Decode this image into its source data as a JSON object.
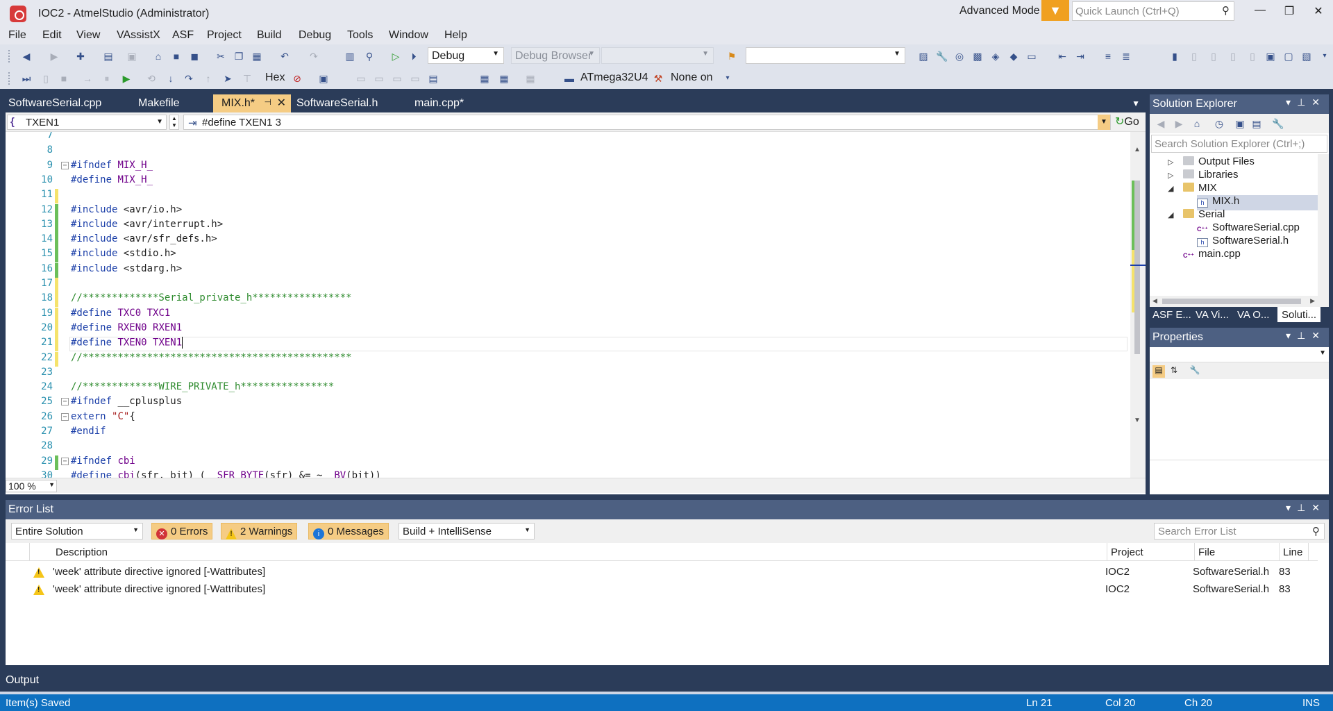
{
  "window": {
    "title": "IOC2 - AtmelStudio (Administrator)",
    "mode": "Advanced Mode",
    "quick_launch_placeholder": "Quick Launch (Ctrl+Q)"
  },
  "menu": [
    "File",
    "Edit",
    "View",
    "VAssistX",
    "ASF",
    "Project",
    "Build",
    "Debug",
    "Tools",
    "Window",
    "Help"
  ],
  "toolbar": {
    "config": "Debug",
    "debug_browser": "Debug Browser",
    "hex_label": "Hex",
    "device": "ATmega32U4",
    "tool": "None on"
  },
  "tabs": [
    {
      "label": "SoftwareSerial.cpp",
      "active": false
    },
    {
      "label": "Makefile",
      "active": false
    },
    {
      "label": "MIX.h*",
      "active": true
    },
    {
      "label": "SoftwareSerial.h",
      "active": false
    },
    {
      "label": "main.cpp*",
      "active": false
    }
  ],
  "editor": {
    "scope_combo": "TXEN1",
    "symbol_combo": "#define TXEN1 3",
    "go_label": "Go",
    "zoom": "100 %",
    "lines": [
      {
        "n": "7",
        "tokens": []
      },
      {
        "n": "8",
        "tokens": []
      },
      {
        "n": "9",
        "fold": "−",
        "tokens": [
          [
            "kw",
            "#ifndef "
          ],
          [
            "mac",
            "MIX_H_"
          ]
        ]
      },
      {
        "n": "10",
        "tokens": [
          [
            "kw",
            "#define "
          ],
          [
            "mac",
            "MIX_H_"
          ]
        ]
      },
      {
        "n": "11",
        "chg": "y",
        "tokens": []
      },
      {
        "n": "12",
        "chg": "g",
        "tokens": [
          [
            "kw",
            "#include "
          ],
          [
            "id",
            "<avr/io.h>"
          ]
        ]
      },
      {
        "n": "13",
        "chg": "g",
        "tokens": [
          [
            "kw",
            "#include "
          ],
          [
            "id",
            "<avr/interrupt.h>"
          ]
        ]
      },
      {
        "n": "14",
        "chg": "g",
        "tokens": [
          [
            "kw",
            "#include "
          ],
          [
            "id",
            "<avr/sfr_defs.h>"
          ]
        ]
      },
      {
        "n": "15",
        "chg": "g",
        "tokens": [
          [
            "kw",
            "#include "
          ],
          [
            "id",
            "<stdio.h>"
          ]
        ]
      },
      {
        "n": "16",
        "chg": "g",
        "tokens": [
          [
            "kw",
            "#include "
          ],
          [
            "id",
            "<stdarg.h>"
          ]
        ]
      },
      {
        "n": "17",
        "chg": "y",
        "tokens": []
      },
      {
        "n": "18",
        "chg": "y",
        "tokens": [
          [
            "cm",
            "//*************Serial_private_h*****************"
          ]
        ]
      },
      {
        "n": "19",
        "chg": "y",
        "tokens": [
          [
            "kw",
            "#define "
          ],
          [
            "mac",
            "TXC0 TXC1"
          ]
        ]
      },
      {
        "n": "20",
        "chg": "y",
        "tokens": [
          [
            "kw",
            "#define "
          ],
          [
            "mac",
            "RXEN0 RXEN1"
          ]
        ]
      },
      {
        "n": "21",
        "chg": "y",
        "current": true,
        "tokens": [
          [
            "kw",
            "#define "
          ],
          [
            "mac",
            "TXEN0 TXEN1"
          ]
        ]
      },
      {
        "n": "22",
        "chg": "y",
        "tokens": [
          [
            "cm",
            "//**********************************************"
          ]
        ]
      },
      {
        "n": "23",
        "tokens": []
      },
      {
        "n": "24",
        "tokens": [
          [
            "cm",
            "//*************WIRE_PRIVATE_h****************"
          ]
        ]
      },
      {
        "n": "25",
        "fold": "−",
        "tokens": [
          [
            "kw",
            "#ifndef "
          ],
          [
            "id",
            "__cplusplus"
          ]
        ]
      },
      {
        "n": "26",
        "fold": "−",
        "tokens": [
          [
            "kw",
            "extern "
          ],
          [
            "str",
            "\"C\""
          ],
          [
            "id",
            "{"
          ]
        ]
      },
      {
        "n": "27",
        "tokens": [
          [
            "kw",
            "#endif"
          ]
        ]
      },
      {
        "n": "28",
        "tokens": []
      },
      {
        "n": "29",
        "chg": "g",
        "fold": "−",
        "tokens": [
          [
            "kw",
            "#ifndef "
          ],
          [
            "mac",
            "cbi"
          ]
        ]
      },
      {
        "n": "30",
        "tokens": [
          [
            "kw",
            "#define "
          ],
          [
            "mac",
            "cbi"
          ],
          [
            "id",
            "(sfr, bit) ( "
          ],
          [
            "mac",
            "_SFR_BYTE"
          ],
          [
            "id",
            "(sfr) &= ~ "
          ],
          [
            "mac",
            "_BV"
          ],
          [
            "id",
            "(bit))"
          ]
        ]
      }
    ]
  },
  "solution_explorer": {
    "title": "Solution Explorer",
    "search_placeholder": "Search Solution Explorer (Ctrl+;)",
    "items": [
      {
        "label": "Output Files",
        "icon": "gfold",
        "tri": "▷",
        "indent": 1
      },
      {
        "label": "Libraries",
        "icon": "gfold",
        "tri": "▷",
        "indent": 1
      },
      {
        "label": "MIX",
        "icon": "folder",
        "tri": "◢",
        "indent": 1
      },
      {
        "label": "MIX.h",
        "icon": "h",
        "tri": "",
        "indent": 2,
        "selected": true
      },
      {
        "label": "Serial",
        "icon": "folder",
        "tri": "◢",
        "indent": 1
      },
      {
        "label": "SoftwareSerial.cpp",
        "icon": "cpp",
        "tri": "",
        "indent": 2
      },
      {
        "label": "SoftwareSerial.h",
        "icon": "h",
        "tri": "",
        "indent": 2
      },
      {
        "label": "main.cpp",
        "icon": "cpp",
        "tri": "",
        "indent": 1
      }
    ],
    "bottom_tabs": [
      "ASF E...",
      "VA Vi...",
      "VA O...",
      "Soluti..."
    ]
  },
  "properties": {
    "title": "Properties"
  },
  "error_list": {
    "title": "Error List",
    "scope": "Entire Solution",
    "errors": "0 Errors",
    "warnings": "2 Warnings",
    "messages": "0 Messages",
    "source": "Build + IntelliSense",
    "search_placeholder": "Search Error List",
    "columns": [
      "Description",
      "Project",
      "File",
      "Line"
    ],
    "rows": [
      {
        "description": "'week' attribute directive ignored [-Wattributes]",
        "project": "IOC2",
        "file": "SoftwareSerial.h",
        "line": "83"
      },
      {
        "description": "'week' attribute directive ignored [-Wattributes]",
        "project": "IOC2",
        "file": "SoftwareSerial.h",
        "line": "83"
      }
    ]
  },
  "output_tab": "Output",
  "status": {
    "message": "Item(s) Saved",
    "ln": "Ln 21",
    "col": "Col 20",
    "ch": "Ch 20",
    "ins": "INS"
  }
}
